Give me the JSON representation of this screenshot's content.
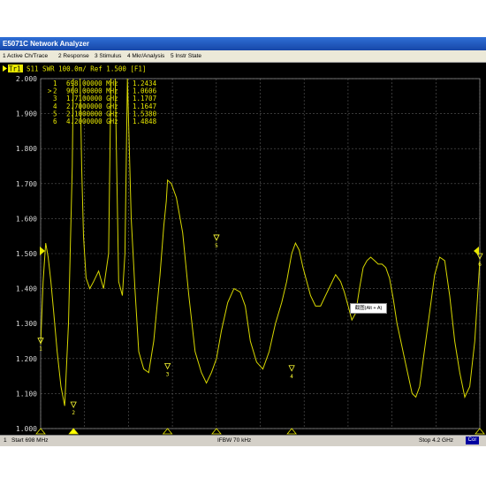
{
  "window": {
    "title": "E5071C Network Analyzer"
  },
  "menu": [
    {
      "label": "1 Active Ch/Trace"
    },
    {
      "label": "2 Response"
    },
    {
      "label": "3 Stimulus"
    },
    {
      "label": "4 Mkr/Analysis"
    },
    {
      "label": "5 Instr State"
    }
  ],
  "trace_header": {
    "badge": "Tr1",
    "text": "S11  SWR 100.0m/ Ref 1.500 [F1]"
  },
  "markers": [
    {
      "prefix": " ",
      "num": "1",
      "freq": "698.00000 MHz",
      "value": "1.2434"
    },
    {
      "prefix": ">",
      "num": "2",
      "freq": "960.00000 MHz",
      "value": "1.0606"
    },
    {
      "prefix": " ",
      "num": "3",
      "freq": "1.7100000 GHz",
      "value": "1.1707"
    },
    {
      "prefix": " ",
      "num": "4",
      "freq": "2.7000000 GHz",
      "value": "1.1647"
    },
    {
      "prefix": " ",
      "num": "5",
      "freq": "2.1000000 GHz",
      "value": "1.5380"
    },
    {
      "prefix": " ",
      "num": "6",
      "freq": "4.2000000 GHz",
      "value": "1.4848"
    }
  ],
  "annotation": "截图(Alt + A)",
  "status": {
    "channel": "1",
    "start": "Start 698 MHz",
    "ifbw": "IFBW 70 kHz",
    "stop": "Stop 4.2 GHz",
    "cor": "Cor"
  },
  "colors": {
    "trace": "#d8d800",
    "grid": "#5a5a5a",
    "marker": "#ffff33",
    "background": "#000000"
  },
  "chart_data": {
    "type": "line",
    "title": "S11  SWR 100.0m/ Ref 1.500 [F1]",
    "xlabel": "",
    "ylabel": "",
    "xlim": [
      0.698,
      4.2
    ],
    "ylim": [
      1.0,
      2.0
    ],
    "yticks": [
      "2.000",
      "1.900",
      "1.800",
      "1.700",
      "1.600",
      "1.500",
      "1.400",
      "1.300",
      "1.200",
      "1.100",
      "1.000"
    ],
    "grid": true,
    "series": [
      {
        "x": [
          0.698,
          0.718,
          0.738,
          0.758,
          0.78,
          0.8,
          0.83,
          0.86,
          0.89,
          0.92,
          0.95,
          0.96,
          0.975,
          0.99,
          1.01,
          1.025,
          1.04,
          1.06,
          1.09,
          1.12,
          1.16,
          1.2,
          1.24,
          1.26,
          1.29,
          1.32,
          1.35,
          1.37,
          1.39,
          1.42,
          1.45,
          1.48,
          1.52,
          1.56,
          1.6,
          1.65,
          1.68,
          1.7,
          1.71,
          1.74,
          1.78,
          1.83,
          1.88,
          1.93,
          1.98,
          2.02,
          2.06,
          2.1,
          2.14,
          2.19,
          2.24,
          2.29,
          2.33,
          2.37,
          2.42,
          2.47,
          2.52,
          2.57,
          2.62,
          2.66,
          2.7,
          2.73,
          2.76,
          2.79,
          2.82,
          2.85,
          2.89,
          2.93,
          2.97,
          3.01,
          3.05,
          3.09,
          3.12,
          3.15,
          3.18,
          3.21,
          3.24,
          3.27,
          3.3,
          3.33,
          3.36,
          3.39,
          3.42,
          3.45,
          3.48,
          3.51,
          3.54,
          3.57,
          3.6,
          3.63,
          3.66,
          3.69,
          3.72,
          3.75,
          3.78,
          3.81,
          3.84,
          3.88,
          3.92,
          3.96,
          4.0,
          4.04,
          4.08,
          4.12,
          4.16,
          4.2
        ],
        "y": [
          1.24,
          1.42,
          1.53,
          1.49,
          1.42,
          1.34,
          1.22,
          1.12,
          1.065,
          1.3,
          1.75,
          2.05,
          2.3,
          2.3,
          2.05,
          1.75,
          1.55,
          1.43,
          1.4,
          1.42,
          1.45,
          1.4,
          1.5,
          2.05,
          2.05,
          1.42,
          1.38,
          1.5,
          2.0,
          1.6,
          1.4,
          1.22,
          1.17,
          1.16,
          1.25,
          1.44,
          1.58,
          1.65,
          1.71,
          1.7,
          1.66,
          1.56,
          1.38,
          1.22,
          1.16,
          1.13,
          1.16,
          1.2,
          1.28,
          1.36,
          1.4,
          1.39,
          1.35,
          1.25,
          1.19,
          1.17,
          1.22,
          1.3,
          1.36,
          1.42,
          1.5,
          1.53,
          1.51,
          1.46,
          1.42,
          1.38,
          1.35,
          1.35,
          1.38,
          1.41,
          1.44,
          1.42,
          1.39,
          1.35,
          1.31,
          1.33,
          1.4,
          1.46,
          1.48,
          1.49,
          1.48,
          1.47,
          1.47,
          1.46,
          1.43,
          1.37,
          1.3,
          1.25,
          1.2,
          1.15,
          1.1,
          1.09,
          1.12,
          1.2,
          1.28,
          1.36,
          1.44,
          1.49,
          1.48,
          1.38,
          1.25,
          1.16,
          1.09,
          1.12,
          1.25,
          1.48
        ]
      }
    ],
    "marker_points": [
      {
        "label": "1",
        "x": 0.698,
        "y": 1.2434
      },
      {
        "label": "2",
        "x": 0.96,
        "y": 1.0606
      },
      {
        "label": "3",
        "x": 1.71,
        "y": 1.1707
      },
      {
        "label": "4",
        "x": 2.7,
        "y": 1.1647
      },
      {
        "label": "5",
        "x": 2.1,
        "y": 1.538
      },
      {
        "label": "6",
        "x": 4.2,
        "y": 1.4848
      }
    ]
  }
}
